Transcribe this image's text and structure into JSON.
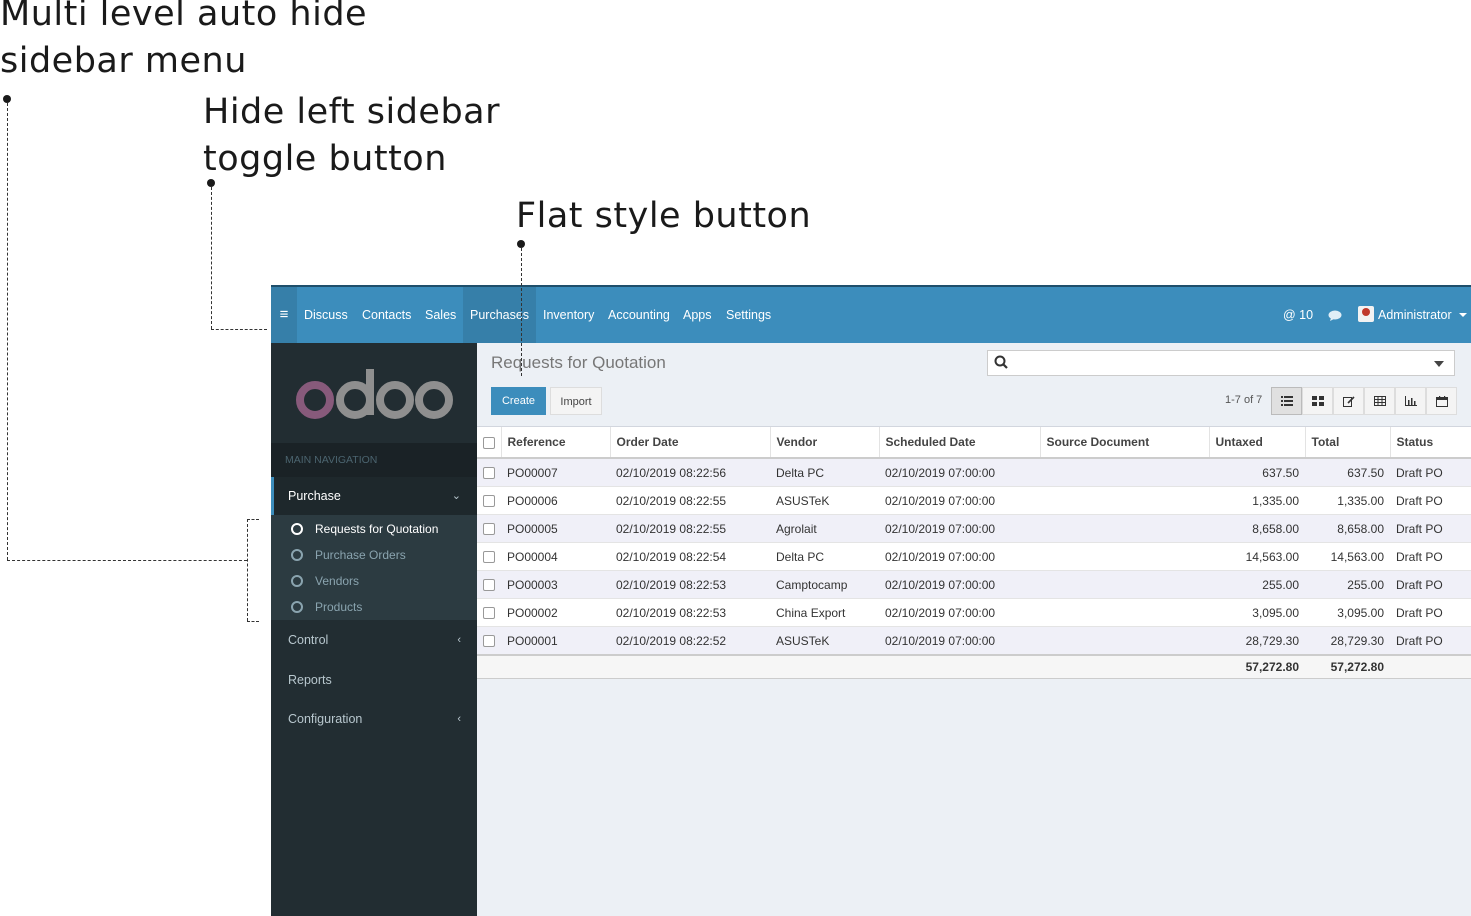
{
  "annotations": {
    "sidebar_menu": "Multi level auto hide\nsidebar menu",
    "toggle_button": "Hide left sidebar\ntoggle button",
    "flat_button": "Flat style button"
  },
  "topbar": {
    "toggle_icon": "≡",
    "menu": [
      "Discuss",
      "Contacts",
      "Sales",
      "Purchases",
      "Inventory",
      "Accounting",
      "Apps",
      "Settings"
    ],
    "active_menu": "Purchases",
    "mentions": "@ 10",
    "user": "Administrator"
  },
  "sidebar": {
    "logo": "odoo",
    "nav_header": "MAIN NAVIGATION",
    "purchase": "Purchase",
    "submenu": [
      "Requests for Quotation",
      "Purchase Orders",
      "Vendors",
      "Products"
    ],
    "control": "Control",
    "reports": "Reports",
    "configuration": "Configuration"
  },
  "control_panel": {
    "breadcrumb": "Requests for Quotation",
    "create_label": "Create",
    "import_label": "Import",
    "pager": "1-7 of 7"
  },
  "table": {
    "columns": [
      "Reference",
      "Order Date",
      "Vendor",
      "Scheduled Date",
      "Source Document",
      "Untaxed",
      "Total",
      "Status"
    ],
    "rows": [
      [
        "PO00007",
        "02/10/2019 08:22:56",
        "Delta PC",
        "02/10/2019 07:00:00",
        "",
        "637.50",
        "637.50",
        "Draft PO"
      ],
      [
        "PO00006",
        "02/10/2019 08:22:55",
        "ASUSTeK",
        "02/10/2019 07:00:00",
        "",
        "1,335.00",
        "1,335.00",
        "Draft PO"
      ],
      [
        "PO00005",
        "02/10/2019 08:22:55",
        "Agrolait",
        "02/10/2019 07:00:00",
        "",
        "8,658.00",
        "8,658.00",
        "Draft PO"
      ],
      [
        "PO00004",
        "02/10/2019 08:22:54",
        "Delta PC",
        "02/10/2019 07:00:00",
        "",
        "14,563.00",
        "14,563.00",
        "Draft PO"
      ],
      [
        "PO00003",
        "02/10/2019 08:22:53",
        "Camptocamp",
        "02/10/2019 07:00:00",
        "",
        "255.00",
        "255.00",
        "Draft PO"
      ],
      [
        "PO00002",
        "02/10/2019 08:22:53",
        "China Export",
        "02/10/2019 07:00:00",
        "",
        "3,095.00",
        "3,095.00",
        "Draft PO"
      ],
      [
        "PO00001",
        "02/10/2019 08:22:52",
        "ASUSTeK",
        "02/10/2019 07:00:00",
        "",
        "28,729.30",
        "28,729.30",
        "Draft PO"
      ]
    ],
    "total_untaxed": "57,272.80",
    "total_total": "57,272.80"
  },
  "colors": {
    "topbar": "#3c8dbc",
    "sidebar": "#222d32",
    "logo_o": "#875a7b",
    "logo_doo": "#8f8f8f"
  }
}
